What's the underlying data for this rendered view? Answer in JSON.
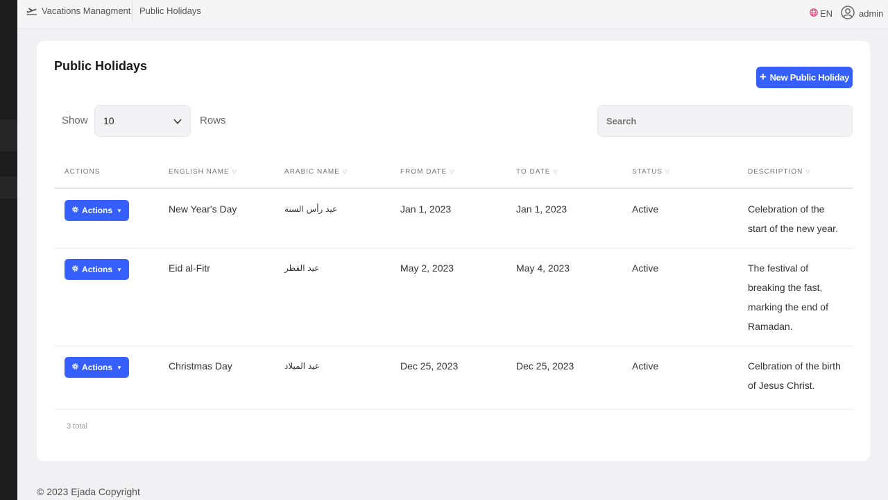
{
  "topbar": {
    "brand": "Vacations Managment",
    "breadcrumb": "Public Holidays",
    "language": "EN",
    "user": "admin"
  },
  "page": {
    "title": "Public Holidays",
    "new_button": "New Public Holiday",
    "show_label": "Show",
    "rows_value": "10",
    "rows_label": "Rows",
    "search_placeholder": "Search"
  },
  "table": {
    "headers": [
      "ACTIONS",
      "ENGLISH NAME",
      "ARABIC NAME",
      "FROM DATE",
      "TO DATE",
      "STATUS",
      "DESCRIPTION"
    ],
    "action_label": "Actions",
    "rows": [
      {
        "english": "New Year's Day",
        "arabic": "عيد رأس السنة",
        "from": "Jan 1, 2023",
        "to": "Jan 1, 2023",
        "status": "Active",
        "description": "Celebration of the start of the new year."
      },
      {
        "english": "Eid al-Fitr",
        "arabic": "عيد الفطر",
        "from": "May 2, 2023",
        "to": "May 4, 2023",
        "status": "Active",
        "description": "The festival of breaking the fast, marking the end of Ramadan."
      },
      {
        "english": "Christmas Day",
        "arabic": "عيد الميلاد",
        "from": "Dec 25, 2023",
        "to": "Dec 25, 2023",
        "status": "Active",
        "description": "Celbration of the birth of Jesus Christ."
      }
    ],
    "total": "3 total"
  },
  "footer": "© 2023 Ejada Copyright",
  "colors": {
    "accent": "#3560ff",
    "background": "#f1f1f3",
    "card": "#ffffff",
    "lang_icon": "#e0457b"
  },
  "icons": [
    "plane-icon",
    "globe-icon",
    "user-circle-icon",
    "plus-icon",
    "chevron-down-icon",
    "gear-icon",
    "caret-down-icon",
    "sort-caret-icon"
  ]
}
